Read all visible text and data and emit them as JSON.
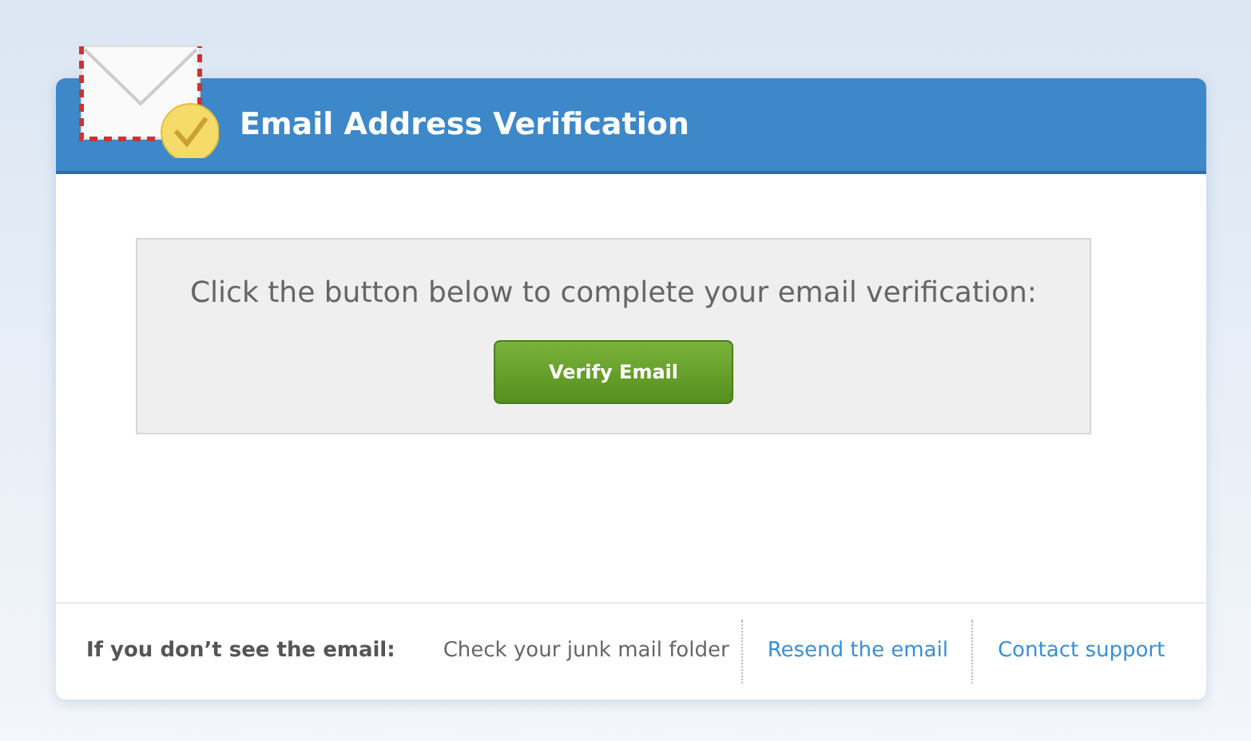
{
  "header": {
    "title": "Email Address Verification"
  },
  "prompt": {
    "message": "Click the button below to complete your email verification:",
    "button": "Verify Email"
  },
  "footer": {
    "label": "If you don’t see the email:",
    "items": [
      {
        "kind": "text",
        "text": "Check your junk mail folder"
      },
      {
        "kind": "link",
        "text": "Resend the email"
      },
      {
        "kind": "link",
        "text": "Contact support"
      }
    ]
  }
}
